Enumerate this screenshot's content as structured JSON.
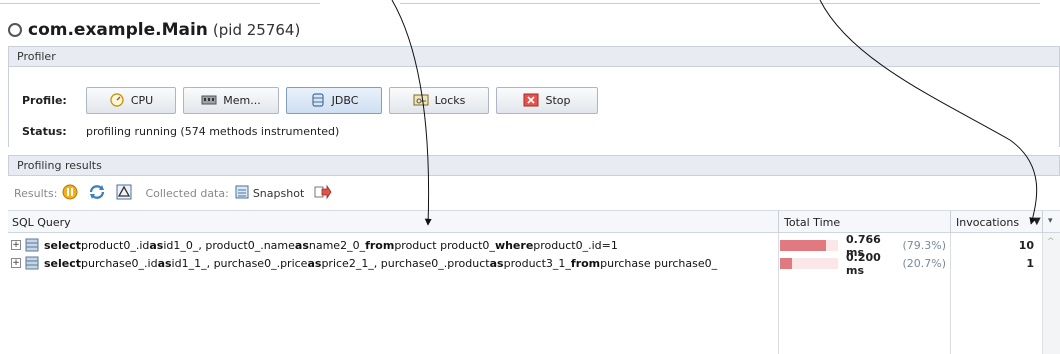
{
  "window": {
    "app_name": "com.example.Main",
    "pid_text": "(pid 25764)"
  },
  "profiler_section": {
    "title": "Profiler",
    "profile_label": "Profile:",
    "buttons": [
      {
        "label": "CPU",
        "icon": "cpu-gauge-icon"
      },
      {
        "label": "Mem...",
        "icon": "memory-chip-icon"
      },
      {
        "label": "JDBC",
        "icon": "database-icon",
        "active": true
      },
      {
        "label": "Locks",
        "icon": "locks-icon"
      },
      {
        "label": "Stop",
        "icon": "stop-icon"
      }
    ],
    "status_label": "Status:",
    "status_text": "profiling running (574 methods instrumented)"
  },
  "results_section": {
    "title": "Profiling results",
    "results_label": "Results:",
    "collected_label": "Collected data:",
    "snapshot_label": "Snapshot"
  },
  "table": {
    "headers": {
      "query": "SQL Query",
      "total_time": "Total Time",
      "invocations": "Invocations"
    },
    "rows": [
      {
        "q1": "select",
        "q2": " product0_.id",
        "q3": "as",
        "q4": " id1_0_, product0_.name",
        "q5": "as",
        "q6": " name2_0_",
        "q7": "from",
        "q8": " product product0_",
        "q9": "where",
        "q10": " product0_.id=1",
        "time": "0.766 ms",
        "pct": "(79.3%)",
        "fraction": 0.793,
        "invocations": "10"
      },
      {
        "q1": "select",
        "q2": " purchase0_.id ",
        "q3": "as",
        "q4": " id1_1_, purchase0_.price",
        "q5": "as",
        "q6": " price2_1_, purchase0_.product",
        "q7": "as",
        "q8": " product3_1_",
        "q9": "from",
        "q10": " purchase purchase0_",
        "time": "0.200 ms",
        "pct": "(20.7%)",
        "fraction": 0.207,
        "invocations": "1"
      }
    ]
  },
  "colors": {
    "bar": "#e07a80",
    "bar_bg": "#fbe7e8",
    "header_bg": "#e8ecf2"
  }
}
